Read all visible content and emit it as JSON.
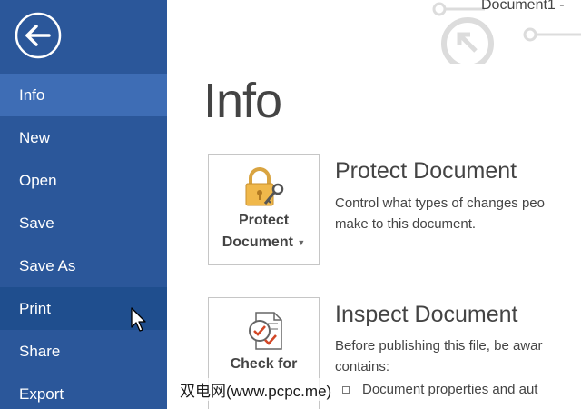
{
  "window": {
    "title": "Document1 -"
  },
  "sidebar": {
    "back_label": "back",
    "items": [
      {
        "label": "Info"
      },
      {
        "label": "New"
      },
      {
        "label": "Open"
      },
      {
        "label": "Save"
      },
      {
        "label": "Save As"
      },
      {
        "label": "Print"
      },
      {
        "label": "Share"
      },
      {
        "label": "Export"
      }
    ],
    "active_item": "Info",
    "hover_item": "Print"
  },
  "main": {
    "title": "Info",
    "sections": [
      {
        "tile_label_line1": "Protect",
        "tile_label_line2": "Document",
        "title": "Protect Document",
        "desc_line1": "Control what types of changes peo",
        "desc_line2": "make to this document.",
        "icon": "lock-key-icon"
      },
      {
        "tile_label_line1": "Check for",
        "title": "Inspect Document",
        "desc_line1": "Before publishing this file, be awar",
        "desc_line2": "contains:",
        "bullet": "Document properties and aut",
        "icon": "inspect-document-icon"
      }
    ]
  },
  "watermark": "双电网(www.pcpc.me)",
  "colors": {
    "sidebar": "#2b579a",
    "sidebar_active": "#3e6db5",
    "sidebar_hover": "#1f4e8e",
    "text": "#444444"
  }
}
